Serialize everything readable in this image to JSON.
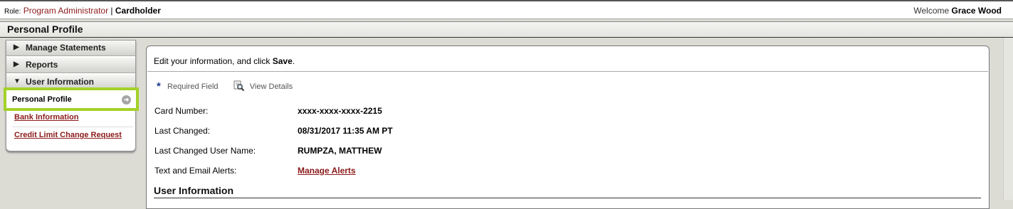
{
  "header": {
    "role_label": "Role:",
    "role_link": "Program Administrator",
    "role_sep": "|",
    "role_current": "Cardholder",
    "welcome_label": "Welcome",
    "user_name": "Grace Wood"
  },
  "page_title": "Personal Profile",
  "sidebar": {
    "sections": [
      {
        "label": "Manage Statements",
        "expanded": false,
        "arrow": "▶"
      },
      {
        "label": "Reports",
        "expanded": false,
        "arrow": "▶"
      },
      {
        "label": "User Information",
        "expanded": true,
        "arrow": "▼"
      }
    ],
    "items": [
      {
        "label": "Personal Profile",
        "active": true
      },
      {
        "label": "Bank Information",
        "active": false
      },
      {
        "label": "Credit Limit Change Request",
        "active": false
      }
    ]
  },
  "main": {
    "intro_prefix": "Edit your information, and click ",
    "intro_bold": "Save",
    "intro_suffix": ".",
    "required_star": "*",
    "required_label": "Required Field",
    "view_details_label": "View Details",
    "fields": [
      {
        "label": "Card Number:",
        "value": "xxxx-xxxx-xxxx-2215"
      },
      {
        "label": "Last Changed:",
        "value": "08/31/2017 11:35 AM PT"
      },
      {
        "label": "Last Changed User Name:",
        "value": "RUMPZA, MATTHEW"
      },
      {
        "label": "Text and Email Alerts:",
        "value": "Manage Alerts",
        "link": true
      }
    ],
    "section_title": "User Information"
  },
  "colors": {
    "accent_highlight": "#a4d12a",
    "link": "#8b1a1a",
    "background": "#dcdbd4"
  }
}
